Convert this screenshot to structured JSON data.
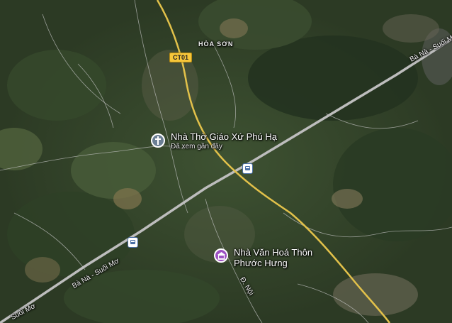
{
  "map": {
    "area_label": "HÒA SƠN",
    "route_shield": "CT01",
    "road_labels": {
      "expressway_ne": "Bà Nà - Suối Mơ",
      "expressway_sw": "Bà Nà - Suối Mơ",
      "expressway_edge": "Suối Mơ",
      "local_road": "Đ. Nội"
    },
    "pois": [
      {
        "name": "Nhà Thờ Giáo Xứ Phú Hạ",
        "subtitle": "Đã xem gần đây",
        "icon": "church-cross-icon",
        "color": "#6b7f94"
      },
      {
        "name": "Nhà Văn Hoá Thôn Phước Hưng",
        "icon": "landmark-building-icon",
        "color": "#9c4fc2"
      }
    ],
    "transit_icons": [
      "bus-stop-icon",
      "bus-stop-icon"
    ],
    "colors": {
      "expressway": "#c9c9c9",
      "highway": "#e8c44a",
      "local_road": "#b9b9b9"
    }
  }
}
